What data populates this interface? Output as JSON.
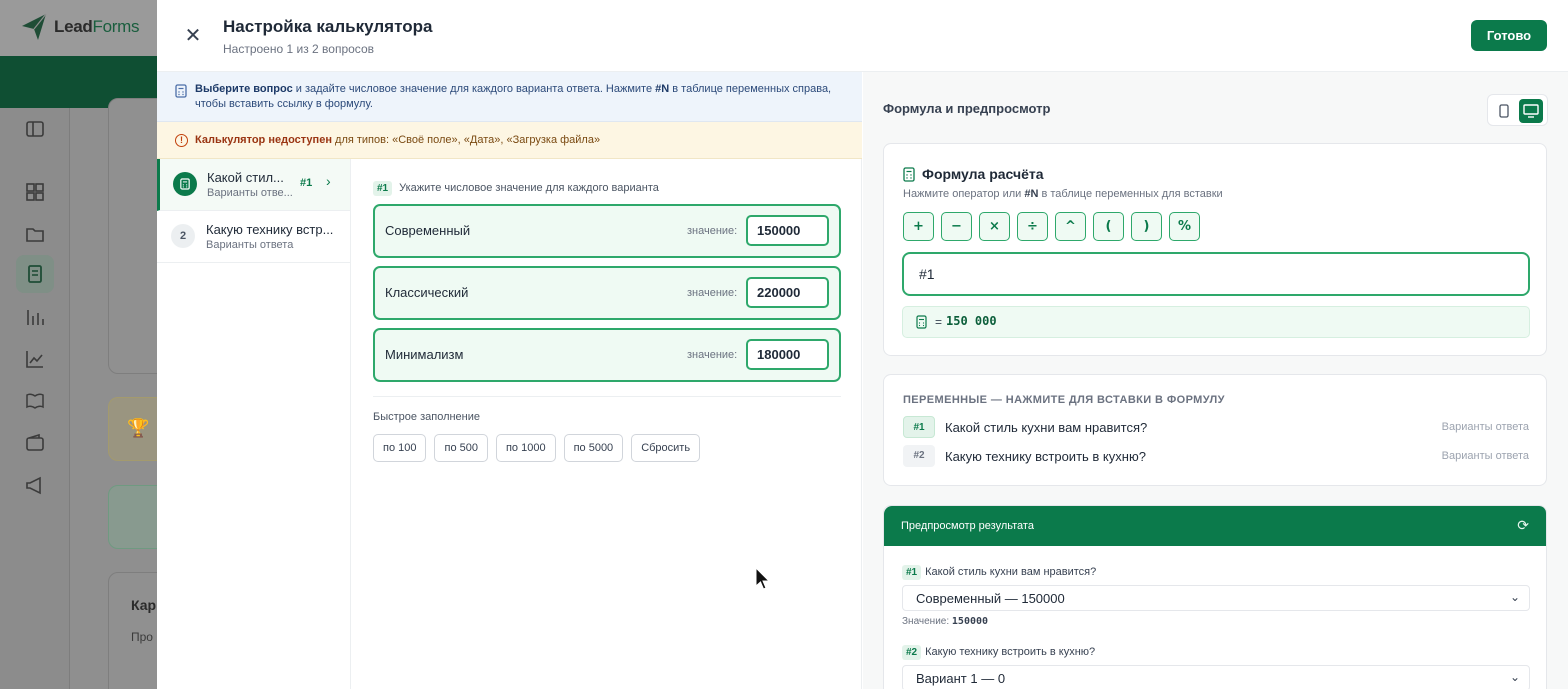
{
  "background": {
    "logo_text_a": "Lead",
    "logo_text_b": "Forms",
    "trophy_icon": "trophy-icon",
    "card_text_a": "Кар",
    "card_text_b": "Про"
  },
  "header": {
    "title": "Настройка калькулятора",
    "subtitle": "Настроено 1 из 2 вопросов",
    "done_label": "Готово"
  },
  "info": {
    "bold": "Выберите вопрос",
    "text_a": " и задайте числовое значение для каждого варианта ответа. Нажмите ",
    "code": "#N",
    "text_b": " в таблице переменных справа, чтобы вставить ссылку в формулу."
  },
  "warning": {
    "bold": "Калькулятор недоступен",
    "text": " для типов: «Своё поле», «Дата», «Загрузка файла»"
  },
  "questions": [
    {
      "num": "",
      "title": "Какой стил...",
      "subtitle": "Варианты отве...",
      "tag": "#1"
    },
    {
      "num": "2",
      "title": "Какую технику встр...",
      "subtitle": "Варианты ответа"
    }
  ],
  "options_panel": {
    "tag": "#1",
    "instruction": "Укажите числовое значение для каждого варианта",
    "value_label": "значение:",
    "options": [
      {
        "name": "Современный",
        "value": "150000"
      },
      {
        "name": "Классический",
        "value": "220000"
      },
      {
        "name": "Минимализм",
        "value": "180000"
      }
    ],
    "quick_title": "Быстрое заполнение",
    "quick_buttons": [
      "по 100",
      "по 500",
      "по 1000",
      "по 5000",
      "Сбросить"
    ]
  },
  "right": {
    "title": "Формула и предпросмотр",
    "formula_title": "Формула расчёта",
    "hint_a": "Нажмите оператор или ",
    "hint_code": "#N",
    "hint_b": " в таблице переменных для вставки",
    "operators": [
      "+",
      "−",
      "×",
      "÷",
      "^",
      "(",
      ")",
      "%"
    ],
    "formula_value": "#1",
    "result_eq": "=",
    "result_value": "150 000",
    "vars_title": "ПЕРЕМЕННЫЕ — НАЖМИТЕ ДЛЯ ВСТАВКИ В ФОРМУЛУ",
    "variables": [
      {
        "tag": "#1",
        "name": "Какой стиль кухни вам нравится?",
        "type": "Варианты ответа"
      },
      {
        "tag": "#2",
        "name": "Какую технику встроить в кухню?",
        "type": "Варианты ответа"
      }
    ],
    "preview_title": "Предпросмотр результата",
    "preview": [
      {
        "tag": "#1",
        "question": "Какой стиль кухни вам нравится?",
        "selected": "Современный — 150000",
        "value_label": "Значение:",
        "value": "150000"
      },
      {
        "tag": "#2",
        "question": "Какую технику встроить в кухню?",
        "selected": "Вариант 1 — 0"
      }
    ]
  },
  "colors": {
    "accent": "#0b7a4b",
    "accent_light": "#effaf3",
    "border_green": "#2ea86b",
    "warn": "#9a3412"
  }
}
